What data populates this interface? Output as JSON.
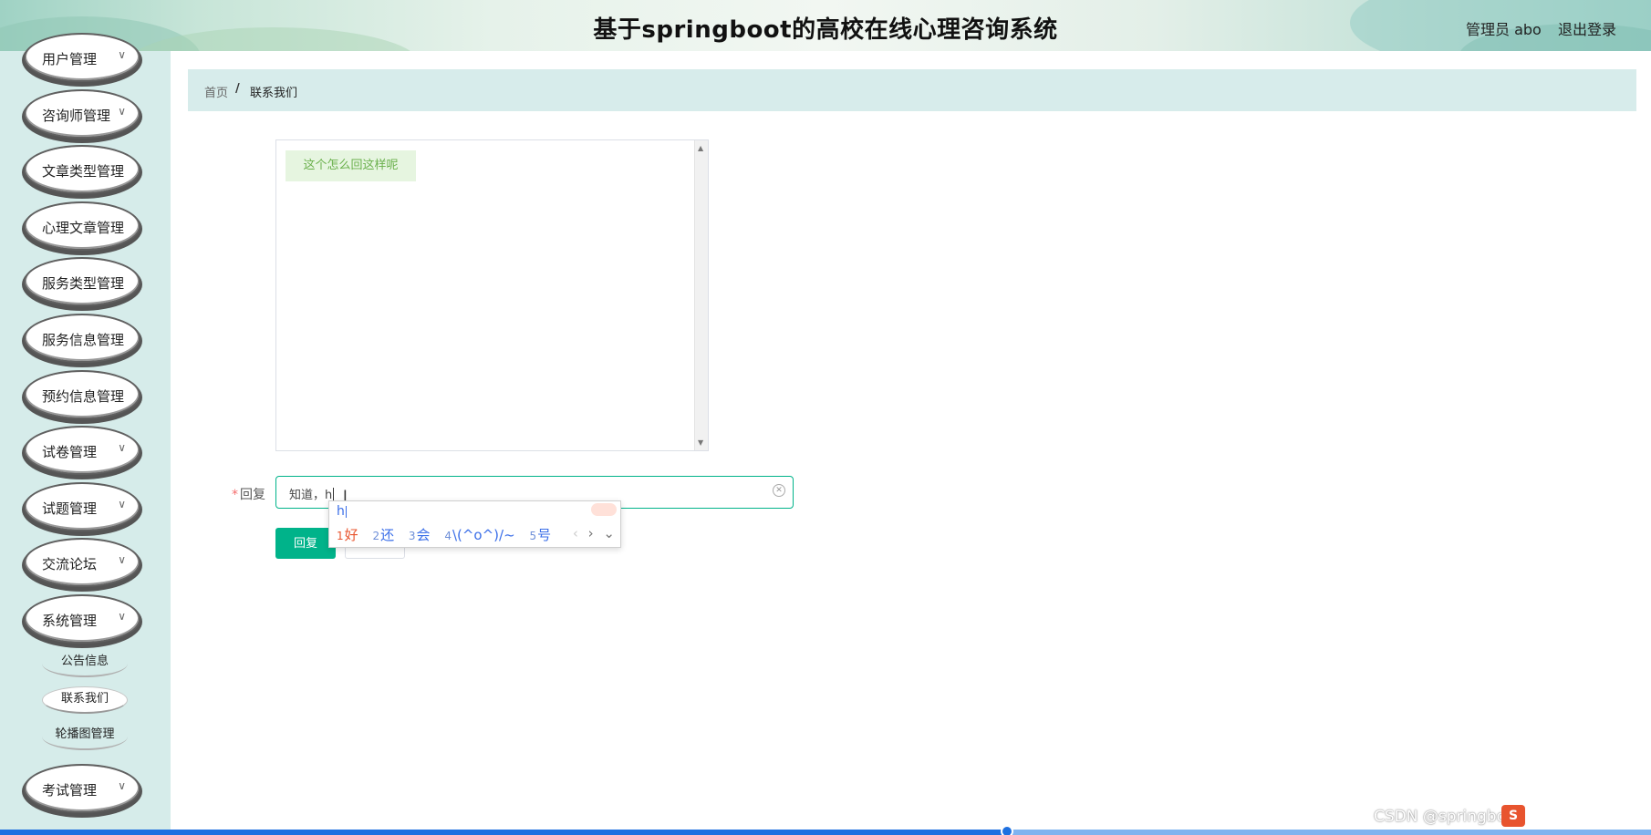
{
  "header": {
    "title": "基于springboot的高校在线心理咨询系统",
    "user": "管理员 abo",
    "logout": "退出登录"
  },
  "sidebar": {
    "items": [
      {
        "label": "用户管理",
        "chevron": "chevron-down-icon"
      },
      {
        "label": "咨询师管理",
        "chevron": "chevron-down-icon"
      },
      {
        "label": "文章类型管理"
      },
      {
        "label": "心理文章管理"
      },
      {
        "label": "服务类型管理"
      },
      {
        "label": "服务信息管理"
      },
      {
        "label": "预约信息管理"
      },
      {
        "label": "试卷管理",
        "chevron": "chevron-down-icon"
      },
      {
        "label": "试题管理",
        "chevron": "chevron-down-icon"
      },
      {
        "label": "交流论坛",
        "chevron": "chevron-down-icon"
      },
      {
        "label": "系统管理",
        "chevron": "chevron-down-icon"
      },
      {
        "label": "考试管理",
        "chevron": "chevron-down-icon"
      }
    ],
    "subitems": [
      {
        "label": "公告信息"
      },
      {
        "label": "联系我们",
        "active": true
      },
      {
        "label": "轮播图管理"
      }
    ]
  },
  "breadcrumb": {
    "home": "首页",
    "separator": "/",
    "current": "联系我们"
  },
  "chat": {
    "messages": [
      "这个怎么回这样呢"
    ]
  },
  "form": {
    "reply_label": "回复",
    "required_mark": "*",
    "reply_value": "知道，h",
    "submit_label": "回复"
  },
  "ime": {
    "composition": "h",
    "candidates": [
      {
        "num": "1",
        "text": "好"
      },
      {
        "num": "2",
        "text": "还"
      },
      {
        "num": "3",
        "text": "会"
      },
      {
        "num": "4",
        "text": "\\(^o^)/~"
      },
      {
        "num": "5",
        "text": "号"
      }
    ],
    "nav": {
      "prev": "‹",
      "next": "›",
      "more": "⌄"
    }
  },
  "watermark": {
    "text": "CSDN @springboot",
    "logo_text": "S"
  },
  "video_progress": 0.61,
  "colors": {
    "accent": "#00b38a",
    "sidebar_bg": "#d6ecea",
    "breadcrumb_bg": "#d7eceb",
    "chat_bubble_bg": "#e6f5e0",
    "chat_bubble_text": "#6ab04c",
    "ime_candidate": "#3a6ee8",
    "ime_first": "#e8542e"
  }
}
